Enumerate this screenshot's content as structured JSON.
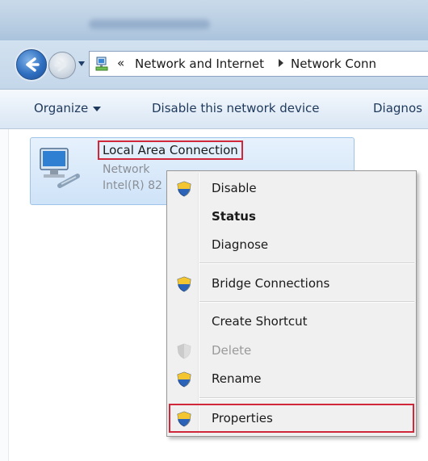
{
  "window": {
    "title": ""
  },
  "address": {
    "back_icon": "back-arrow-icon",
    "forward_icon": "forward-arrow-icon",
    "chevron": "«",
    "crumbs": [
      "Network and Internet",
      "Network Conn"
    ]
  },
  "toolbar": {
    "organize": "Organize",
    "disable": "Disable this network device",
    "diagnose": "Diagnos"
  },
  "connection": {
    "name": "Local Area Connection",
    "status_line": "Network",
    "adapter_line": "Intel(R) 82"
  },
  "context_menu": {
    "items": [
      {
        "label": "Disable",
        "icon": "uac-shield-icon",
        "bold": false,
        "enabled": true
      },
      {
        "label": "Status",
        "icon": "",
        "bold": true,
        "enabled": true
      },
      {
        "label": "Diagnose",
        "icon": "",
        "bold": false,
        "enabled": true
      },
      {
        "label": "Bridge Connections",
        "icon": "uac-shield-icon",
        "bold": false,
        "enabled": true
      },
      {
        "label": "Create Shortcut",
        "icon": "",
        "bold": false,
        "enabled": true
      },
      {
        "label": "Delete",
        "icon": "uac-shield-icon",
        "bold": false,
        "enabled": false
      },
      {
        "label": "Rename",
        "icon": "uac-shield-icon",
        "bold": false,
        "enabled": true
      },
      {
        "label": "Properties",
        "icon": "uac-shield-icon",
        "bold": false,
        "enabled": true
      }
    ]
  },
  "colors": {
    "highlight_box": "#d0283a",
    "toolbar_text": "#1e395b",
    "tile_border": "#9ec4ea"
  }
}
